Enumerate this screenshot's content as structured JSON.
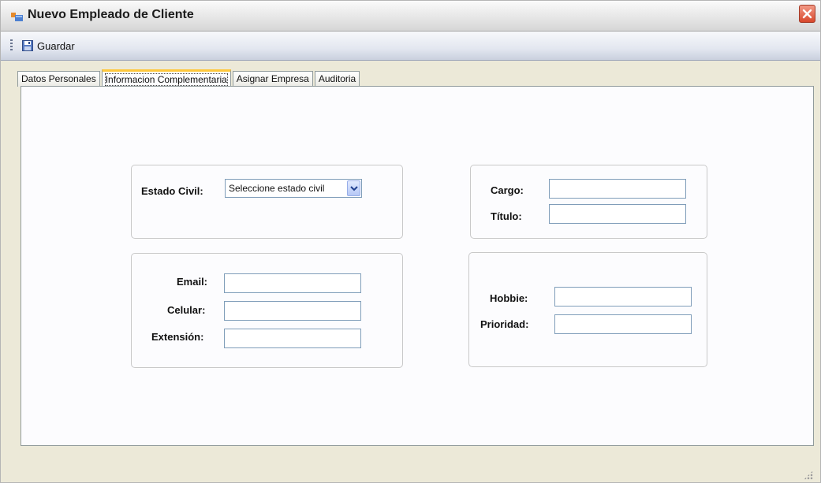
{
  "window": {
    "title": "Nuevo Empleado de Cliente"
  },
  "toolbar": {
    "save_label": "Guardar",
    "save_icon": "floppy-disk-icon"
  },
  "tabs": [
    {
      "label": "Datos Personales",
      "active": false
    },
    {
      "label": "Informacion Complementaria",
      "active": true
    },
    {
      "label": "Asignar Empresa",
      "active": false
    },
    {
      "label": "Auditoria",
      "active": false
    }
  ],
  "form": {
    "estado_civil": {
      "label": "Estado Civil:",
      "value": "Seleccione estado civil"
    },
    "cargo": {
      "label": "Cargo:",
      "value": ""
    },
    "titulo": {
      "label": "Título:",
      "value": ""
    },
    "email": {
      "label": "Email:",
      "value": ""
    },
    "celular": {
      "label": "Celular:",
      "value": ""
    },
    "extension": {
      "label": "Extensión:",
      "value": ""
    },
    "hobbie": {
      "label": "Hobbie:",
      "value": ""
    },
    "prioridad": {
      "label": "Prioridad:",
      "value": ""
    }
  },
  "colors": {
    "close_button": "#d8472c",
    "active_tab_accent": "#ffc83c",
    "field_border": "#7f9db9"
  }
}
